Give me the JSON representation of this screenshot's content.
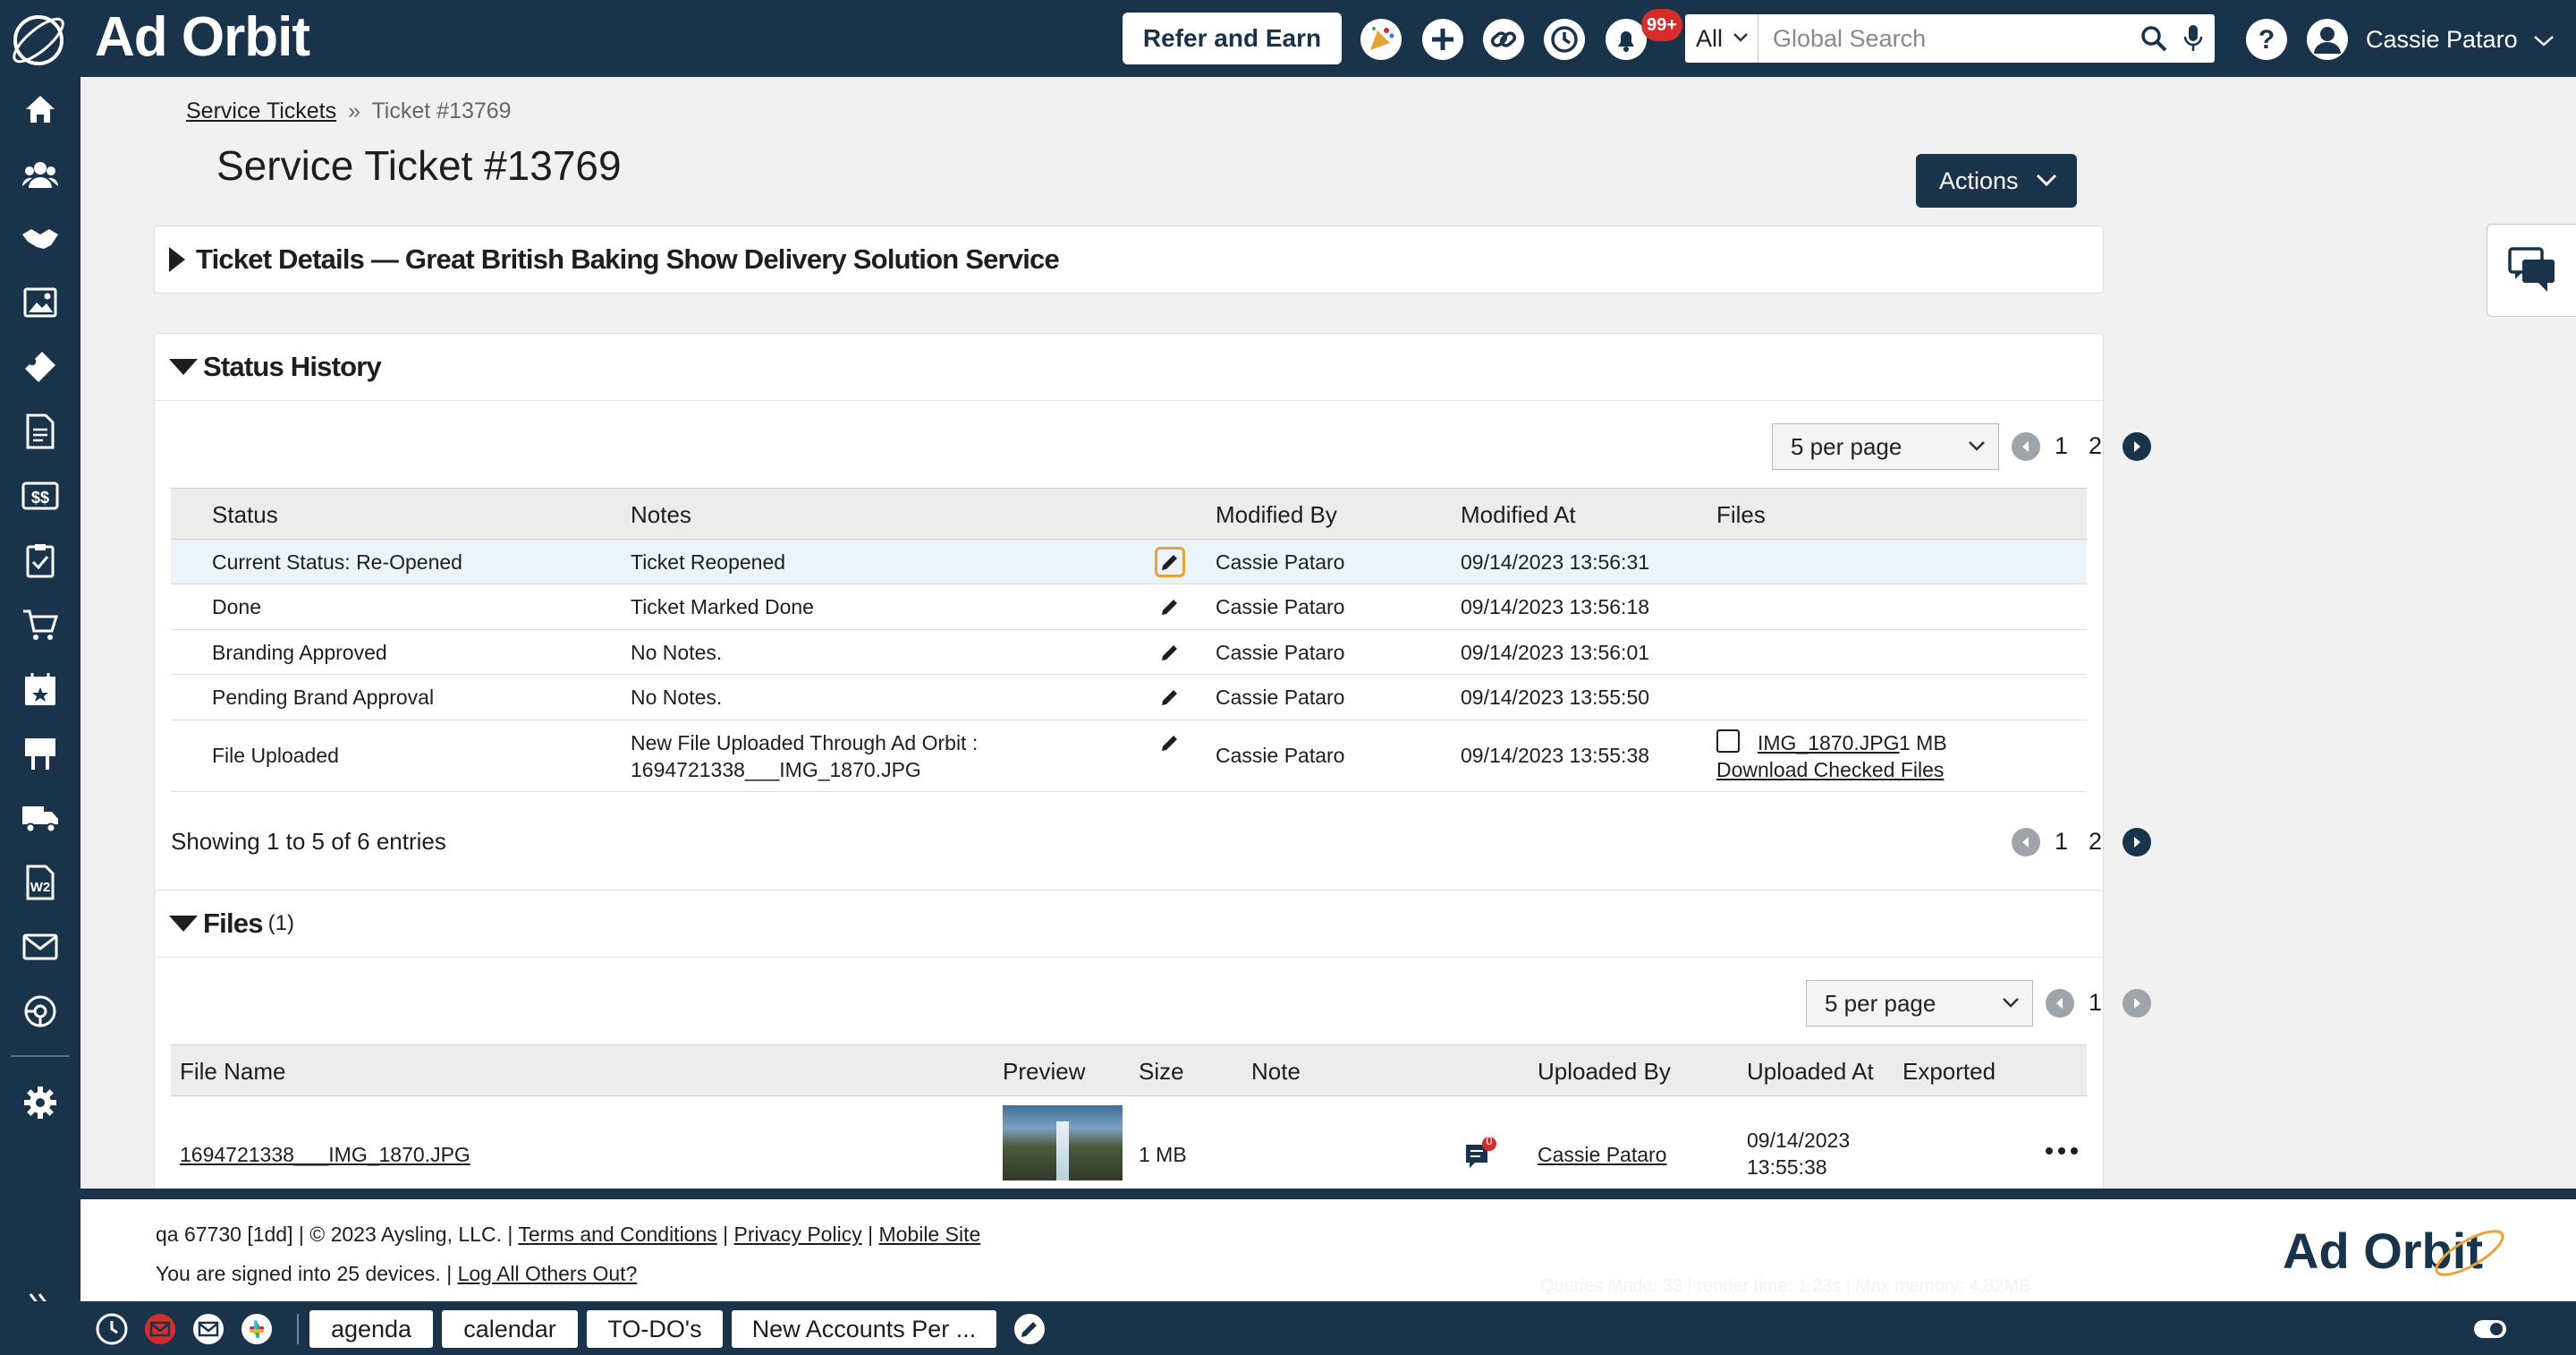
{
  "app": {
    "brand": "Ad Orbit",
    "refer_label": "Refer and Earn",
    "notification_count": "99+",
    "search": {
      "scope": "All",
      "placeholder": "Global Search"
    },
    "user_name": "Cassie Pataro",
    "colors": {
      "navy": "#19344a",
      "badge_red": "#d62c2c",
      "focus_orange": "#e8a23a"
    }
  },
  "sidebar": {
    "icons": [
      "home-icon",
      "users-icon",
      "handshake-icon",
      "media-icon",
      "ticket-icon",
      "invoice-icon",
      "payments-icon",
      "checklist-icon",
      "cart-icon",
      "calendar-icon",
      "billboard-icon",
      "delivery-truck-icon",
      "w2-form-icon",
      "mail-icon",
      "support-icon",
      "settings-icon",
      "expand-icon"
    ]
  },
  "breadcrumb": {
    "parent": "Service Tickets",
    "separator": "»",
    "current": "Ticket #13769"
  },
  "page": {
    "title": "Service Ticket #13769",
    "actions_label": "Actions"
  },
  "ticket_details": {
    "title": "Ticket Details — Great British Baking Show Delivery Solution Service"
  },
  "status_history": {
    "title": "Status History",
    "per_page": "5 per page",
    "pages": [
      "1",
      "2"
    ],
    "columns": [
      "Status",
      "Notes",
      "Modified By",
      "Modified At",
      "Files"
    ],
    "rows": [
      {
        "status": "Current Status: Re-Opened",
        "notes": "Ticket Reopened",
        "modified_by": "Cassie Pataro",
        "modified_at": "09/14/2023 13:56:31"
      },
      {
        "status": "Done",
        "notes": "Ticket Marked Done",
        "modified_by": "Cassie Pataro",
        "modified_at": "09/14/2023 13:56:18"
      },
      {
        "status": "Branding Approved",
        "notes": "No Notes.",
        "modified_by": "Cassie Pataro",
        "modified_at": "09/14/2023 13:56:01"
      },
      {
        "status": "Pending Brand Approval",
        "notes": "No Notes.",
        "modified_by": "Cassie Pataro",
        "modified_at": "09/14/2023 13:55:50"
      },
      {
        "status": "File Uploaded",
        "notes_line1": "New File Uploaded Through Ad Orbit :",
        "notes_line2": "1694721338___IMG_1870.JPG",
        "modified_by": "Cassie Pataro",
        "modified_at": "09/14/2023 13:55:38",
        "file_name": "IMG_1870.JPG",
        "file_size": "1 MB",
        "download_label": "Download Checked Files"
      }
    ],
    "showing": "Showing 1 to 5 of 6 entries"
  },
  "files": {
    "title": "Files",
    "count": "(1)",
    "per_page": "5 per page",
    "pages": [
      "1"
    ],
    "columns": [
      "File Name",
      "Preview",
      "Size",
      "Note",
      "Uploaded By",
      "Uploaded At",
      "Exported"
    ],
    "rows": [
      {
        "file_name": "1694721338___IMG_1870.JPG",
        "size": "1 MB",
        "note_count": "0",
        "uploaded_by": "Cassie Pataro",
        "uploaded_date": "09/14/2023",
        "uploaded_time": "13:55:38"
      }
    ]
  },
  "footer": {
    "build": "qa 67730 [1dd]",
    "copyright": "© 2023 Aysling, LLC.",
    "sep": "|",
    "terms": "Terms and Conditions",
    "privacy": "Privacy Policy",
    "mobile": "Mobile Site",
    "signed_in": "You are signed into 25 devices.",
    "logout_others": "Log All Others Out?",
    "stats": "Queries Made: 33 | render time: 1.23s | Max memory: 4.82MB"
  },
  "taskbar": {
    "buttons": [
      "agenda",
      "calendar",
      "TO-DO's",
      "New Accounts Per ..."
    ]
  }
}
